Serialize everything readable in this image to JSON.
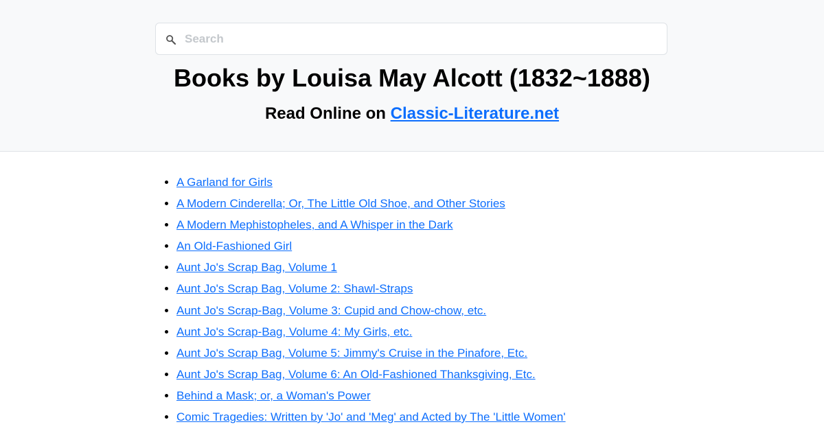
{
  "search": {
    "placeholder": "Search"
  },
  "header": {
    "title": "Books by Louisa May Alcott (1832~1888)",
    "subtitle_prefix": "Read Online on ",
    "site_link": "Classic-Literature.net"
  },
  "colors": {
    "link": "#0d6efd",
    "header_bg": "#f8f9fa"
  },
  "books": [
    "A Garland for Girls",
    "A Modern Cinderella; Or, The Little Old Shoe, and Other Stories",
    "A Modern Mephistopheles, and A Whisper in the Dark",
    "An Old-Fashioned Girl",
    "Aunt Jo's Scrap Bag, Volume 1",
    "Aunt Jo's Scrap Bag, Volume 2: Shawl-Straps",
    "Aunt Jo's Scrap-Bag, Volume 3: Cupid and Chow-chow, etc.",
    "Aunt Jo's Scrap-Bag, Volume 4: My Girls, etc.",
    "Aunt Jo's Scrap Bag, Volume 5: Jimmy's Cruise in the Pinafore, Etc.",
    "Aunt Jo's Scrap Bag, Volume 6: An Old-Fashioned Thanksgiving, Etc.",
    "Behind a Mask; or, a Woman's Power",
    "Comic Tragedies: Written by 'Jo' and 'Meg' and Acted by The 'Little Women'"
  ]
}
